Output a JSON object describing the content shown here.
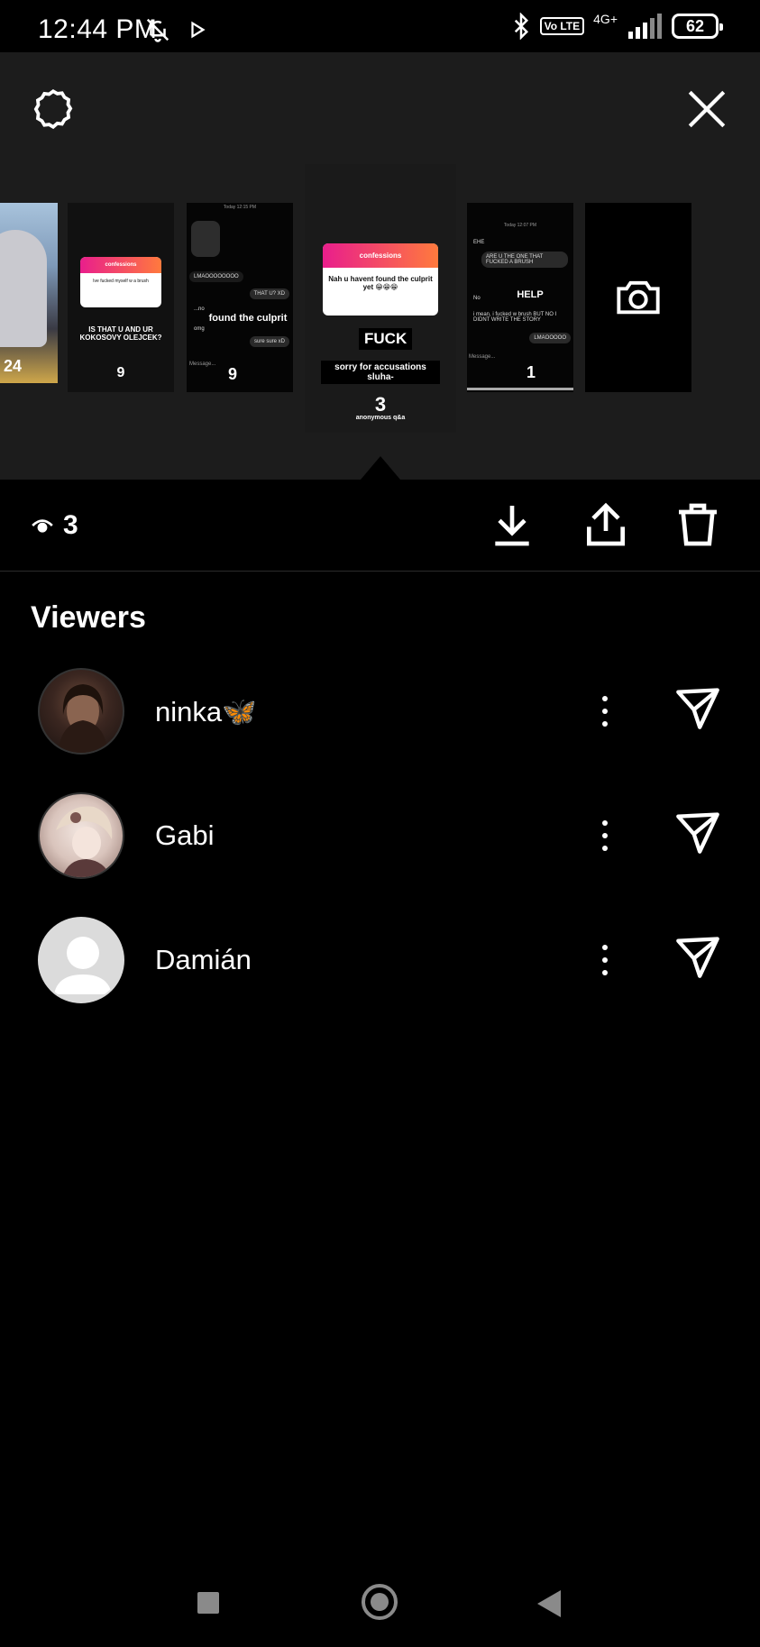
{
  "status_bar": {
    "time": "12:44 PM",
    "volte": "Vo LTE",
    "network": "4G+",
    "battery": "62"
  },
  "story_tray": {
    "thumbs": [
      {
        "count": "24"
      },
      {
        "card_title": "confessions",
        "card_text": "Ive fucked myself w a brush",
        "caption": "IS THAT U AND UR KOKOSOVY OLEJCEK?",
        "count": "9"
      },
      {
        "header": "Today 12:15 PM",
        "caption": "found the culprit",
        "bubbles": [
          "THAT U? XD",
          "LMAOOOOOOOO",
          "...no",
          "sure sure xD",
          "omg"
        ],
        "input": "Message...",
        "count": "9"
      },
      {
        "card_title": "confessions",
        "card_text": "Nah u havent found the culprit yet 😁😁😁",
        "word": "FUCK",
        "caption": "sorry for accusations sluha-",
        "brand": "anonymous q&a",
        "count": "3"
      },
      {
        "header": "Today 12:07 PM",
        "caption": "HELP",
        "bubbles": [
          "EHE",
          "ARE U THE ONE THAT FUCKED A BRUSH",
          "No",
          "i mean, i fucked w brush BUT NO I DIDNT WRITE THE STORY",
          "LMAOOOOO"
        ],
        "input": "Message...",
        "count": "1"
      }
    ]
  },
  "actions": {
    "view_count": "3"
  },
  "viewers": {
    "title": "Viewers",
    "list": [
      {
        "name": "ninka🦋"
      },
      {
        "name": "Gabi"
      },
      {
        "name": "Damián"
      }
    ]
  }
}
